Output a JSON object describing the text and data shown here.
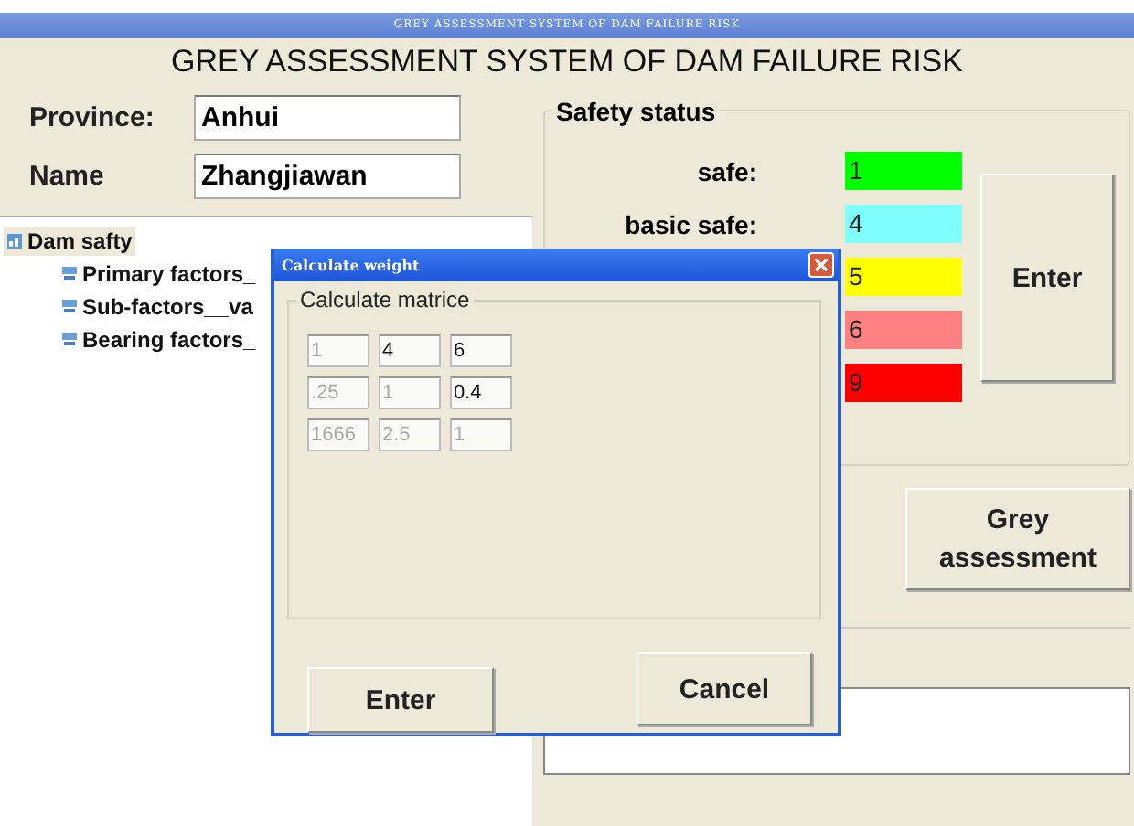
{
  "window": {
    "title": "GREY ASSESSMENT SYSTEM OF DAM FAILURE RISK"
  },
  "heading": "GREY ASSESSMENT SYSTEM OF DAM FAILURE RISK",
  "fields": [
    {
      "label": "Province:",
      "value": "Anhui"
    },
    {
      "label": "Name",
      "value": "Zhangjiawan"
    }
  ],
  "tree": [
    {
      "label": "Dam safty",
      "selected": true,
      "children": [
        {
          "label": "Primary factors_",
          "selected": false
        },
        {
          "label": "Sub-factors__va",
          "selected": false
        },
        {
          "label": "Bearing factors_",
          "selected": false
        }
      ]
    }
  ],
  "safety_status": {
    "title": "Safety status",
    "levels": [
      {
        "label": "safe:",
        "value": "1",
        "color": "#00ff00"
      },
      {
        "label": "basic safe:",
        "value": "4",
        "color": "#80ffff"
      },
      {
        "value": "5",
        "color": "#ffff00"
      },
      {
        "value": "6",
        "color": "#ff8080"
      },
      {
        "value": "9",
        "color": "#ff0000"
      }
    ],
    "button": "Enter"
  },
  "grey_button": "Grey\nassessment",
  "dialog": {
    "title": "Calculate weight",
    "group": "Calculate matrice",
    "matrix": [
      [
        {
          "value": "1",
          "disabled": true
        },
        {
          "value": "4",
          "disabled": false
        },
        {
          "value": "6",
          "disabled": false
        }
      ],
      [
        {
          "value": ".25",
          "disabled": true
        },
        {
          "value": "1",
          "disabled": true
        },
        {
          "value": "0.4",
          "disabled": false
        }
      ],
      [
        {
          "value": "1666",
          "disabled": true
        },
        {
          "value": "2.5",
          "disabled": true
        },
        {
          "value": "1",
          "disabled": true
        }
      ]
    ],
    "buttons": [
      "Enter",
      "Cancel"
    ]
  }
}
